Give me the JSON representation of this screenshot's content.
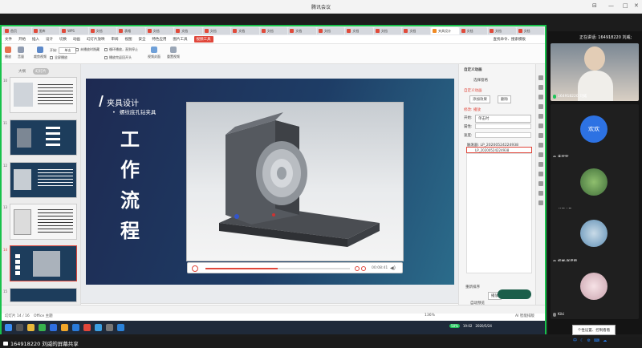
{
  "meeting": {
    "title": "腾讯会议",
    "speaking_label": "正在讲话: 164918220 刘威;",
    "share_label": "164918220 刘威的屏幕共享",
    "tooltip": "个性设置、控制看看"
  },
  "browser": {
    "tabs": [
      "首页",
      "图库",
      "WPS",
      "文档",
      "表格",
      "文档",
      "文档",
      "文档",
      "文档",
      "文档",
      "文档",
      "文档",
      "文档",
      "文档",
      "文档",
      "夹具设计",
      "文档",
      "文档",
      "文档"
    ],
    "active_tab_index": 15
  },
  "wps": {
    "menu": [
      "文件",
      "开始",
      "插入",
      "设计",
      "切换",
      "动画",
      "幻灯片放映",
      "审阅",
      "视图",
      "安全",
      "特色应用",
      "图片工具",
      "视频工具"
    ],
    "highlighted_menu": "视频工具",
    "search_label": "查找命令、搜索模板",
    "ribbon": {
      "play": "播放",
      "volume": "音量",
      "trim": "裁剪视频",
      "start_label": "开始:",
      "start_value": "单击",
      "fullscreen": "全屏播放",
      "hide": "未播放时隐藏",
      "loop": "循环播放，直到停止",
      "rewind": "播放完返回开头",
      "cover": "视频封面",
      "reset": "重置视频"
    }
  },
  "left_panel": {
    "tabs": [
      "大纲",
      "幻灯片"
    ],
    "slide_numbers": [
      "10",
      "11",
      "12",
      "13",
      "14",
      "15"
    ],
    "selected_slide": "14",
    "add_slide": "+"
  },
  "slide": {
    "title": "夹具设计",
    "subtitle": "螺纹底孔钻夹具",
    "vertical_chars": [
      "工",
      "作",
      "流",
      "程"
    ],
    "video_time": "00:08:41"
  },
  "right_pane": {
    "header": "自定义动画",
    "select_pane": "选择窗格",
    "custom_anim": "自定义动画",
    "add_effect": "添加效果",
    "remove": "删除",
    "modify_label": "修改: 播放",
    "start_label": "开始:",
    "start_value": "单击时",
    "property_label": "属性:",
    "speed_label": "速度:",
    "trigger_label": "触发器: LP_20200524224938",
    "item_label": "LP_20200524224938",
    "reorder": "重新排序",
    "play_btn": "播放",
    "autopreview": "自动预览"
  },
  "status": {
    "slide_info": "幻灯片 14 / 16",
    "theme": "Office 主题",
    "notes_placeholder": "单击此处添加备注",
    "zoom": "136%",
    "smart_label": "AI 智能排版"
  },
  "taskbar": {
    "time": "19:02",
    "date": "2020/5/24",
    "battery": "58%"
  },
  "participants": [
    {
      "name": "164918220 刘威",
      "kind": "video",
      "avatar_color": "#d8c6b4"
    },
    {
      "name": "朱欢欢",
      "kind": "text-avatar",
      "avatar_text": "欢欢",
      "avatar_color": "#2d72e3"
    },
    {
      "name": "长江之歌",
      "kind": "photo",
      "avatar_color": "#4f8a4a"
    },
    {
      "name": "机械-张老师",
      "kind": "photo",
      "avatar_color": "#7aa8c9"
    },
    {
      "name": "Kiki",
      "kind": "photo",
      "avatar_color": "#e7c7cf"
    }
  ],
  "colors": {
    "accent": "#e0463a",
    "share_border": "#18c24b",
    "slide_bg": "#1e3a64"
  }
}
